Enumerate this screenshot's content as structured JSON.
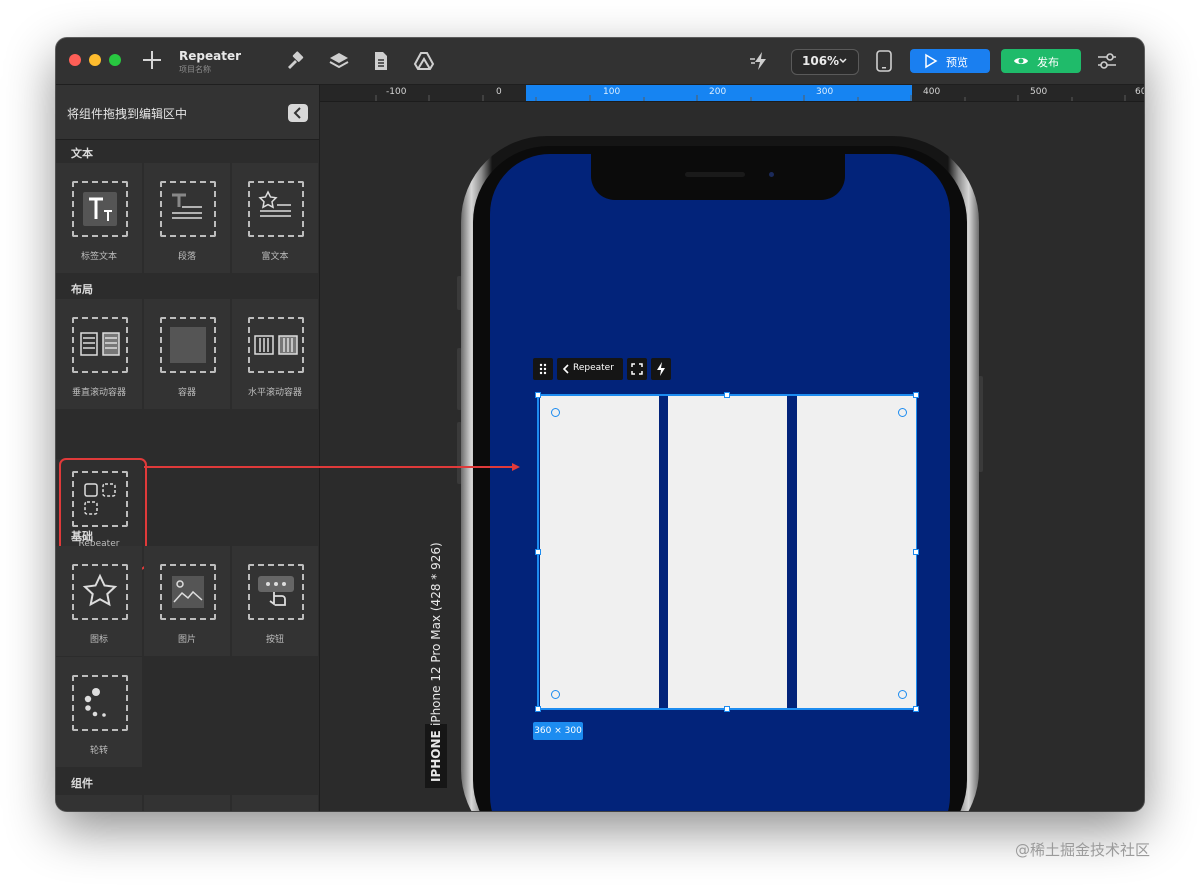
{
  "titlebar": {
    "project_name": "Repeater",
    "project_sub": "项目名称",
    "zoom": "106%",
    "preview_label": "预览",
    "publish_label": "发布"
  },
  "sidebar": {
    "title": "将组件拖拽到编辑区中",
    "sections": {
      "text": "文本",
      "layout": "布局",
      "basic": "基础",
      "components": "组件"
    },
    "tiles": {
      "label_text": "标签文本",
      "paragraph": "段落",
      "rich_text": "富文本",
      "vertical_scroll": "垂直滚动容器",
      "container": "容器",
      "horizontal_scroll": "水平滚动容器",
      "repeater": "Repeater",
      "icon": "图标",
      "image": "图片",
      "button": "按钮",
      "spinner": "轮转"
    }
  },
  "ruler": {
    "labels": [
      "-100",
      "0",
      "100",
      "200",
      "300",
      "400",
      "500",
      "60"
    ]
  },
  "canvas": {
    "device_tag": "IPHONE",
    "device_name": "iPhone 12 Pro Max (428 * 926)",
    "repeater_toolbar_label": "Repeater",
    "size_badge": "360 × 300"
  },
  "watermark": "@稀土掘金技术社区",
  "colors": {
    "accent": "#1d8cf0",
    "preview_button": "#1a7ff0",
    "publish_button": "#1fbb6a",
    "screen_background": "#02237a",
    "callout_red": "#e03a3a"
  }
}
